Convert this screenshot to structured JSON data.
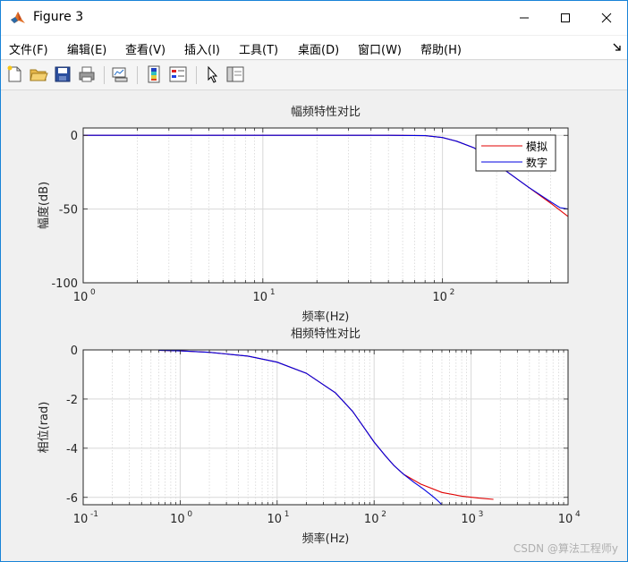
{
  "window": {
    "title": "Figure 3"
  },
  "menu": {
    "items": [
      "文件(F)",
      "编辑(E)",
      "查看(V)",
      "插入(I)",
      "工具(T)",
      "桌面(D)",
      "窗口(W)",
      "帮助(H)"
    ]
  },
  "toolbar": {
    "icons": [
      "new-figure-icon",
      "open-file-icon",
      "save-icon",
      "print-icon",
      "link-plot-icon",
      "insert-colorbar-icon",
      "insert-legend-icon",
      "pointer-icon",
      "plot-browser-icon"
    ]
  },
  "colors": {
    "analog": "#e00000",
    "digital": "#0000e0",
    "grid": "#d8d8d8",
    "titlebar_accent": "#1883d7"
  },
  "chart_data": [
    {
      "type": "line",
      "title": "幅频特性对比",
      "xlabel": "频率(Hz)",
      "ylabel": "幅度(dB)",
      "xscale": "log",
      "xlim": [
        1,
        500
      ],
      "ylim": [
        -100,
        5
      ],
      "yticks": [
        "0",
        "-50",
        "-100"
      ],
      "ytick_values": [
        0,
        -50,
        -100
      ],
      "xticks": [
        "10",
        "10",
        "10"
      ],
      "xtick_exponents": [
        "0",
        "1",
        "2"
      ],
      "xtick_values": [
        1,
        10,
        100
      ],
      "grid": true,
      "legend": {
        "placement": "top-right",
        "entries": [
          "模拟",
          "数字"
        ]
      },
      "series": [
        {
          "name": "模拟",
          "color": "#e00000",
          "x": [
            1,
            10,
            50,
            80,
            100,
            120,
            150,
            200,
            250,
            300,
            400,
            500
          ],
          "y": [
            0,
            0,
            0,
            -0.2,
            -1.5,
            -4,
            -8.5,
            -19.5,
            -28,
            -35,
            -46,
            -55
          ]
        },
        {
          "name": "数字",
          "color": "#0000e0",
          "x": [
            1,
            10,
            50,
            80,
            100,
            120,
            150,
            200,
            250,
            300,
            400,
            450,
            500
          ],
          "y": [
            0,
            0,
            0,
            -0.2,
            -1.5,
            -4,
            -8.5,
            -19.5,
            -28,
            -35,
            -45,
            -49,
            -50
          ]
        }
      ]
    },
    {
      "type": "line",
      "title": "相频特性对比",
      "xlabel": "频率(Hz)",
      "ylabel": "相位(rad)",
      "xscale": "log",
      "xlim": [
        0.1,
        10000
      ],
      "ylim": [
        -6.3,
        0
      ],
      "yticks": [
        "0",
        "-2",
        "-4",
        "-6"
      ],
      "ytick_values": [
        0,
        -2,
        -4,
        -6
      ],
      "xticks": [
        "10",
        "10",
        "10",
        "10",
        "10",
        "10"
      ],
      "xtick_exponents": [
        "-1",
        "0",
        "1",
        "2",
        "3",
        "4"
      ],
      "xtick_values": [
        0.1,
        1,
        10,
        100,
        1000,
        10000
      ],
      "grid": true,
      "series": [
        {
          "name": "模拟",
          "color": "#e00000",
          "x": [
            0.6,
            1,
            2,
            5,
            10,
            20,
            40,
            60,
            80,
            100,
            130,
            160,
            200,
            300,
            500,
            800,
            1200,
            1700
          ],
          "y": [
            -0.02,
            -0.04,
            -0.1,
            -0.25,
            -0.5,
            -0.95,
            -1.75,
            -2.5,
            -3.2,
            -3.75,
            -4.3,
            -4.7,
            -5.05,
            -5.45,
            -5.8,
            -5.95,
            -6.03,
            -6.08
          ]
        },
        {
          "name": "数字",
          "color": "#0000e0",
          "x": [
            0.6,
            1,
            2,
            5,
            10,
            20,
            40,
            60,
            80,
            100,
            130,
            160,
            200,
            260,
            320,
            400,
            450,
            500
          ],
          "y": [
            -0.02,
            -0.04,
            -0.1,
            -0.25,
            -0.5,
            -0.95,
            -1.75,
            -2.5,
            -3.2,
            -3.75,
            -4.3,
            -4.7,
            -5.05,
            -5.4,
            -5.65,
            -5.95,
            -6.12,
            -6.3
          ]
        }
      ]
    }
  ],
  "watermark": "CSDN @算法工程师y"
}
